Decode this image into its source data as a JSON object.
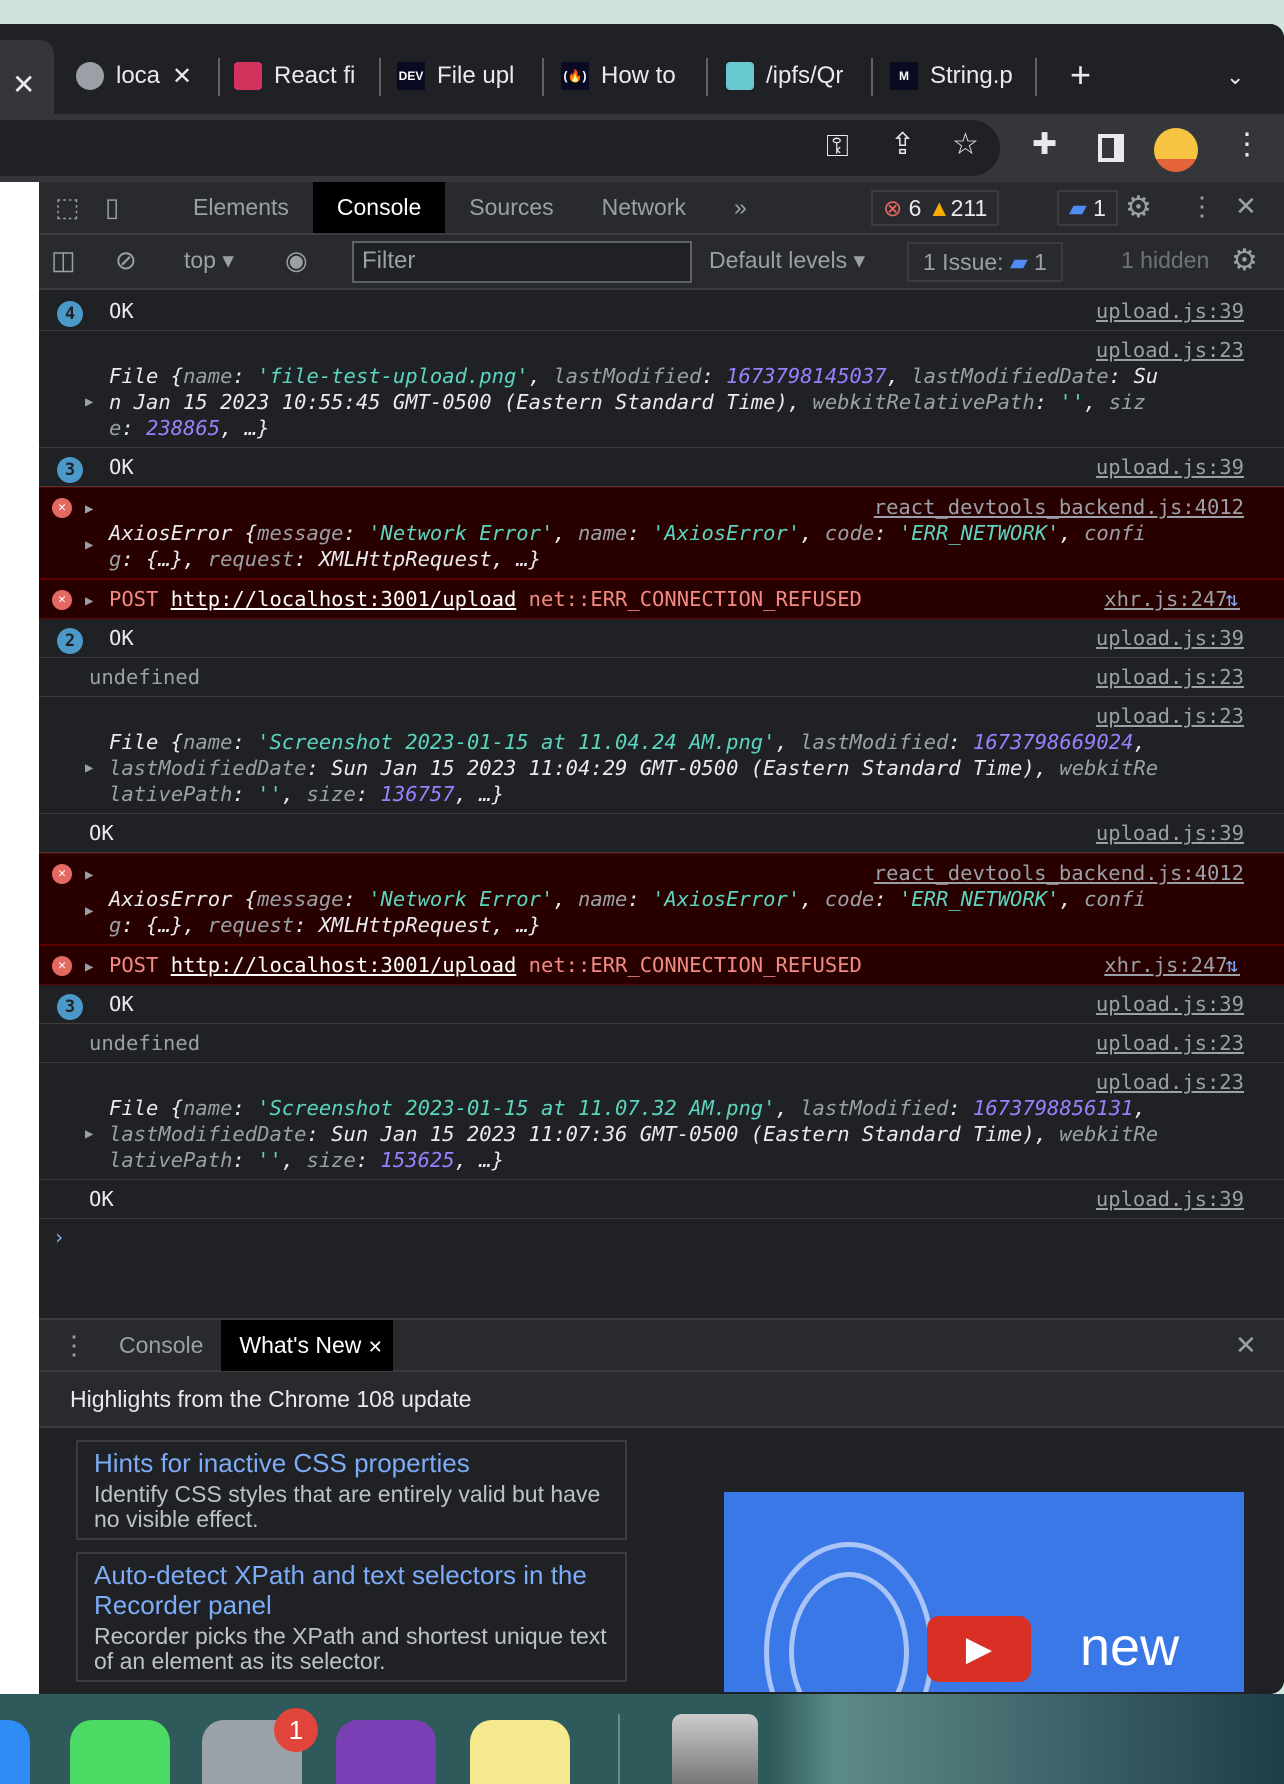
{
  "browser": {
    "tabs": [
      {
        "label": "loca",
        "icon": "globe-icon",
        "favicon_color": "#9aa0a6"
      },
      {
        "label": "React fi",
        "icon": "ruby-gem-icon",
        "favicon_color": "#d2335c"
      },
      {
        "label": "File upl",
        "icon": "dev-logo-icon",
        "favicon_text": "DEV"
      },
      {
        "label": "How to",
        "icon": "freecodecamp-icon",
        "favicon_text": "(🔥)"
      },
      {
        "label": "/ipfs/Qr",
        "icon": "ipfs-cube-icon",
        "favicon_color": "#6acad1"
      },
      {
        "label": "String.p",
        "icon": "mdn-icon",
        "favicon_text": "M"
      }
    ]
  },
  "devtools": {
    "tabs": [
      "Elements",
      "Console",
      "Sources",
      "Network"
    ],
    "active_tab": "Console",
    "errors": "6",
    "warnings": "211",
    "messages_count": "1",
    "context": "top",
    "filter_placeholder": "Filter",
    "levels": "Default levels",
    "issues_label": "1 Issue:",
    "issues_count": "1",
    "hidden": "1 hidden"
  },
  "console": [
    {
      "type": "log",
      "badge": "4",
      "src": "upload.js:39",
      "lines": [
        [
          [
            "OK",
            ""
          ]
        ]
      ]
    },
    {
      "type": "obj",
      "src": "upload.js:23",
      "lines": [
        [
          [
            "File {",
            "p"
          ],
          [
            "name",
            "k"
          ],
          [
            ": ",
            "p"
          ],
          [
            "'file-test-upload.png'",
            "s"
          ],
          [
            ", ",
            "p"
          ],
          [
            "lastModified",
            "k"
          ],
          [
            ": ",
            "p"
          ],
          [
            "1673798145037",
            "n"
          ],
          [
            ", ",
            "p"
          ],
          [
            "lastModifiedDate",
            "k"
          ],
          [
            ": Su",
            "p"
          ]
        ],
        [
          [
            "n Jan 15 2023 10:55:45 GMT-0500 (Eastern Standard Time), ",
            "p"
          ],
          [
            "webkitRelativePath",
            "k"
          ],
          [
            ": ",
            "p"
          ],
          [
            "''",
            "s"
          ],
          [
            ", ",
            "p"
          ],
          [
            "siz",
            "k"
          ]
        ],
        [
          [
            "e",
            "k"
          ],
          [
            ": ",
            "p"
          ],
          [
            "238865",
            "n"
          ],
          [
            ", …}",
            "p"
          ]
        ]
      ]
    },
    {
      "type": "log",
      "badge": "3",
      "src": "upload.js:39",
      "lines": [
        [
          [
            "OK",
            ""
          ]
        ]
      ]
    },
    {
      "type": "errobj",
      "src": "react_devtools_backend.js:4012",
      "lines": [
        [
          [
            "AxiosError {",
            "p"
          ],
          [
            "message",
            "k"
          ],
          [
            ": ",
            "p"
          ],
          [
            "'Network Error'",
            "s"
          ],
          [
            ", ",
            "p"
          ],
          [
            "name",
            "k"
          ],
          [
            ": ",
            "p"
          ],
          [
            "'AxiosError'",
            "s"
          ],
          [
            ", ",
            "p"
          ],
          [
            "code",
            "k"
          ],
          [
            ": ",
            "p"
          ],
          [
            "'ERR_NETWORK'",
            "s"
          ],
          [
            ", ",
            "p"
          ],
          [
            "confi",
            "k"
          ]
        ],
        [
          [
            "g",
            "k"
          ],
          [
            ": {…}, ",
            "p"
          ],
          [
            "request",
            "k"
          ],
          [
            ": XMLHttpRequest, …}",
            "p"
          ]
        ]
      ]
    },
    {
      "type": "errnet",
      "src": "xhr.js:247",
      "method": "POST",
      "url": "http://localhost:3001/upload",
      "error": "net::ERR_CONNECTION_REFUSED"
    },
    {
      "type": "log",
      "badge": "2",
      "src": "upload.js:39",
      "lines": [
        [
          [
            "OK",
            ""
          ]
        ]
      ]
    },
    {
      "type": "log",
      "src": "upload.js:23",
      "lines": [
        [
          [
            "undefined",
            "g"
          ]
        ]
      ]
    },
    {
      "type": "obj",
      "src": "upload.js:23",
      "lines": [
        [
          [
            "File {",
            "p"
          ],
          [
            "name",
            "k"
          ],
          [
            ": ",
            "p"
          ],
          [
            "'Screenshot 2023-01-15 at 11.04.24 AM.png'",
            "s"
          ],
          [
            ", ",
            "p"
          ],
          [
            "lastModified",
            "k"
          ],
          [
            ": ",
            "p"
          ],
          [
            "1673798669024",
            "n"
          ],
          [
            ",",
            "p"
          ]
        ],
        [
          [
            "lastModifiedDate",
            "k"
          ],
          [
            ": Sun Jan 15 2023 11:04:29 GMT-0500 (Eastern Standard Time), ",
            "p"
          ],
          [
            "webkitRe",
            "k"
          ]
        ],
        [
          [
            "lativePath",
            "k"
          ],
          [
            ": ",
            "p"
          ],
          [
            "''",
            "s"
          ],
          [
            ", ",
            "p"
          ],
          [
            "size",
            "k"
          ],
          [
            ": ",
            "p"
          ],
          [
            "136757",
            "n"
          ],
          [
            ", …}",
            "p"
          ]
        ]
      ]
    },
    {
      "type": "log",
      "src": "upload.js:39",
      "lines": [
        [
          [
            "OK",
            ""
          ]
        ]
      ]
    },
    {
      "type": "errobj",
      "src": "react_devtools_backend.js:4012",
      "lines": [
        [
          [
            "AxiosError {",
            "p"
          ],
          [
            "message",
            "k"
          ],
          [
            ": ",
            "p"
          ],
          [
            "'Network Error'",
            "s"
          ],
          [
            ", ",
            "p"
          ],
          [
            "name",
            "k"
          ],
          [
            ": ",
            "p"
          ],
          [
            "'AxiosError'",
            "s"
          ],
          [
            ", ",
            "p"
          ],
          [
            "code",
            "k"
          ],
          [
            ": ",
            "p"
          ],
          [
            "'ERR_NETWORK'",
            "s"
          ],
          [
            ", ",
            "p"
          ],
          [
            "confi",
            "k"
          ]
        ],
        [
          [
            "g",
            "k"
          ],
          [
            ": {…}, ",
            "p"
          ],
          [
            "request",
            "k"
          ],
          [
            ": XMLHttpRequest, …}",
            "p"
          ]
        ]
      ]
    },
    {
      "type": "errnet",
      "src": "xhr.js:247",
      "method": "POST",
      "url": "http://localhost:3001/upload",
      "error": "net::ERR_CONNECTION_REFUSED"
    },
    {
      "type": "log",
      "badge": "3",
      "src": "upload.js:39",
      "lines": [
        [
          [
            "OK",
            ""
          ]
        ]
      ]
    },
    {
      "type": "log",
      "src": "upload.js:23",
      "lines": [
        [
          [
            "undefined",
            "g"
          ]
        ]
      ]
    },
    {
      "type": "obj",
      "src": "upload.js:23",
      "lines": [
        [
          [
            "File {",
            "p"
          ],
          [
            "name",
            "k"
          ],
          [
            ": ",
            "p"
          ],
          [
            "'Screenshot 2023-01-15 at 11.07.32 AM.png'",
            "s"
          ],
          [
            ", ",
            "p"
          ],
          [
            "lastModified",
            "k"
          ],
          [
            ": ",
            "p"
          ],
          [
            "1673798856131",
            "n"
          ],
          [
            ",",
            "p"
          ]
        ],
        [
          [
            "lastModifiedDate",
            "k"
          ],
          [
            ": Sun Jan 15 2023 11:07:36 GMT-0500 (Eastern Standard Time), ",
            "p"
          ],
          [
            "webkitRe",
            "k"
          ]
        ],
        [
          [
            "lativePath",
            "k"
          ],
          [
            ": ",
            "p"
          ],
          [
            "''",
            "s"
          ],
          [
            ", ",
            "p"
          ],
          [
            "size",
            "k"
          ],
          [
            ": ",
            "p"
          ],
          [
            "153625",
            "n"
          ],
          [
            ", …}",
            "p"
          ]
        ]
      ]
    },
    {
      "type": "log",
      "src": "upload.js:39",
      "lines": [
        [
          [
            "OK",
            ""
          ]
        ]
      ]
    }
  ],
  "drawer": {
    "tabs": [
      "Console",
      "What's New"
    ],
    "active_tab": "What's New",
    "highlights": "Highlights from the Chrome 108 update",
    "cards": [
      {
        "title": "Hints for inactive CSS properties",
        "desc": "Identify CSS styles that are entirely valid but have no visible effect."
      },
      {
        "title": "Auto-detect XPath and text selectors in the Recorder panel",
        "desc": "Recorder picks the XPath and shortest unique text of an element as its selector."
      }
    ],
    "video_text": "new"
  },
  "dock": {
    "settings_badge": "1"
  },
  "colors": {
    "error_bg": "#290000",
    "error_text": "#f28b82",
    "string": "#5cd5c0",
    "number": "#9980ff",
    "link": "#7cacf8",
    "badge": "#4b99c9"
  }
}
